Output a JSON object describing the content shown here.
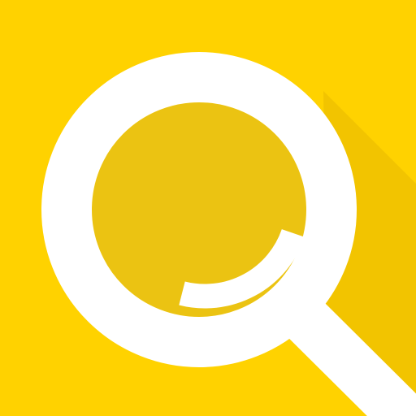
{
  "icon": {
    "name": "search-icon",
    "colors": {
      "background": "#ffd200",
      "long_shadow": "#f2c400",
      "lens_fill": "#ebc312",
      "glyph": "#ffffff"
    }
  }
}
